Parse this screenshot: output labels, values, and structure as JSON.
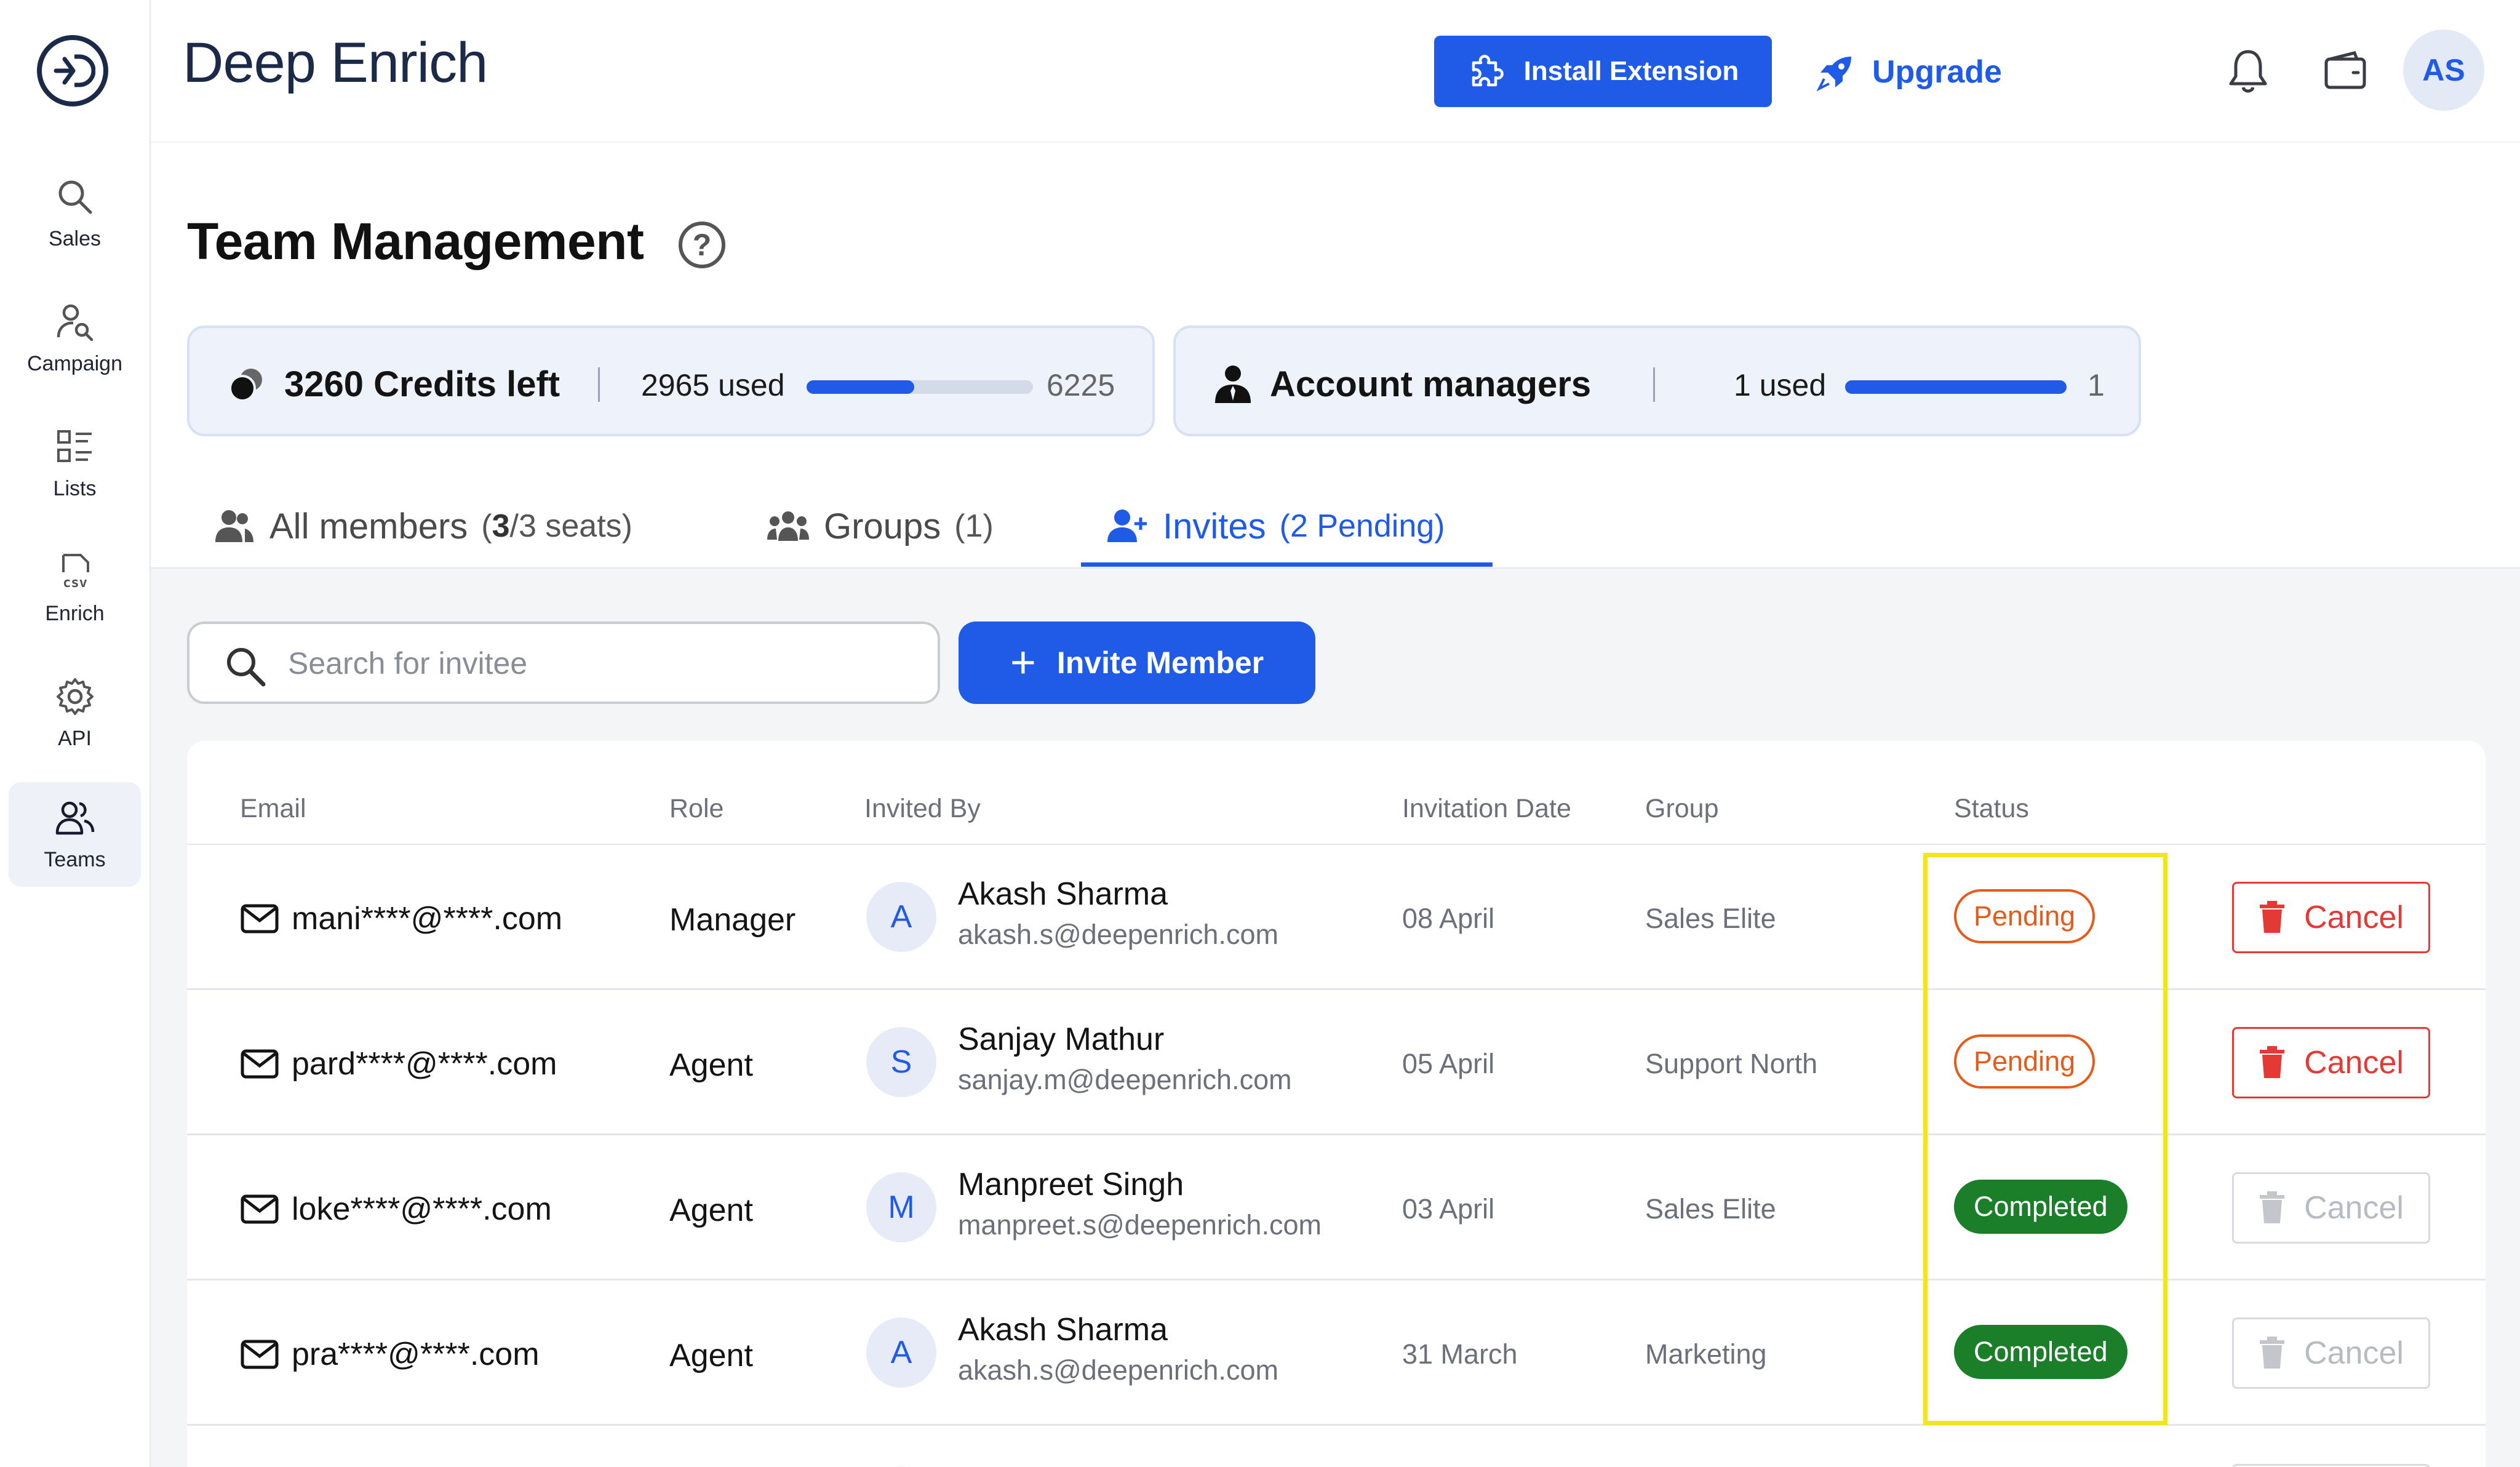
{
  "app": {
    "brand": "Deep Enrich"
  },
  "sidebar": {
    "items": [
      {
        "label": "Sales",
        "icon": "search-icon"
      },
      {
        "label": "Campaign",
        "icon": "person-search-icon"
      },
      {
        "label": "Lists",
        "icon": "list-icon"
      },
      {
        "label": "Enrich",
        "icon": "csv-file-icon"
      },
      {
        "label": "API",
        "icon": "gear-icon"
      },
      {
        "label": "Teams",
        "icon": "users-icon",
        "active": true
      }
    ]
  },
  "header": {
    "install_label": "Install Extension",
    "upgrade_label": "Upgrade",
    "avatar_initials": "AS"
  },
  "page": {
    "title": "Team Management"
  },
  "credits": {
    "title": "3260 Credits left",
    "used_label": "2965 used",
    "total_label": "6225",
    "used": 2965,
    "total": 6225
  },
  "managers": {
    "title": "Account managers",
    "used_label": "1 used",
    "total_label": "1",
    "used": 1,
    "total": 1
  },
  "tabs": [
    {
      "label": "All members",
      "count_prefix": "(",
      "count_bold": "3",
      "count_rest": "/3 seats)"
    },
    {
      "label": "Groups",
      "count": "(1)"
    },
    {
      "label": "Invites",
      "count": "(2 Pending)",
      "active": true
    }
  ],
  "search": {
    "placeholder": "Search for invitee"
  },
  "invite_button": {
    "label": "Invite Member"
  },
  "table": {
    "columns": [
      "Email",
      "Role",
      "Invited By",
      "Invitation Date",
      "Group",
      "Status"
    ],
    "rows": [
      {
        "email": "mani****@****.com",
        "role": "Manager",
        "initial": "A",
        "inviter": "Akash Sharma",
        "inviter_email": "akash.s@deepenrich.com",
        "date": "08 April",
        "group": "Sales Elite",
        "status": "Pending",
        "action": "Cancel"
      },
      {
        "email": "pard****@****.com",
        "role": "Agent",
        "initial": "S",
        "inviter": "Sanjay Mathur",
        "inviter_email": "sanjay.m@deepenrich.com",
        "date": "05 April",
        "group": "Support North",
        "status": "Pending",
        "action": "Cancel"
      },
      {
        "email": "loke****@****.com",
        "role": "Agent",
        "initial": "M",
        "inviter": "Manpreet Singh",
        "inviter_email": "manpreet.s@deepenrich.com",
        "date": "03 April",
        "group": "Sales Elite",
        "status": "Completed",
        "action": "Cancel"
      },
      {
        "email": "pra****@****.com",
        "role": "Agent",
        "initial": "A",
        "inviter": "Akash Sharma",
        "inviter_email": "akash.s@deepenrich.com",
        "date": "31 March",
        "group": "Marketing",
        "status": "Completed",
        "action": "Cancel"
      }
    ]
  },
  "colors": {
    "accent": "#1f5be6",
    "pending": "#e55b1a",
    "completed": "#1b7f2a",
    "danger": "#e53935",
    "highlight": "#f2e41f"
  }
}
